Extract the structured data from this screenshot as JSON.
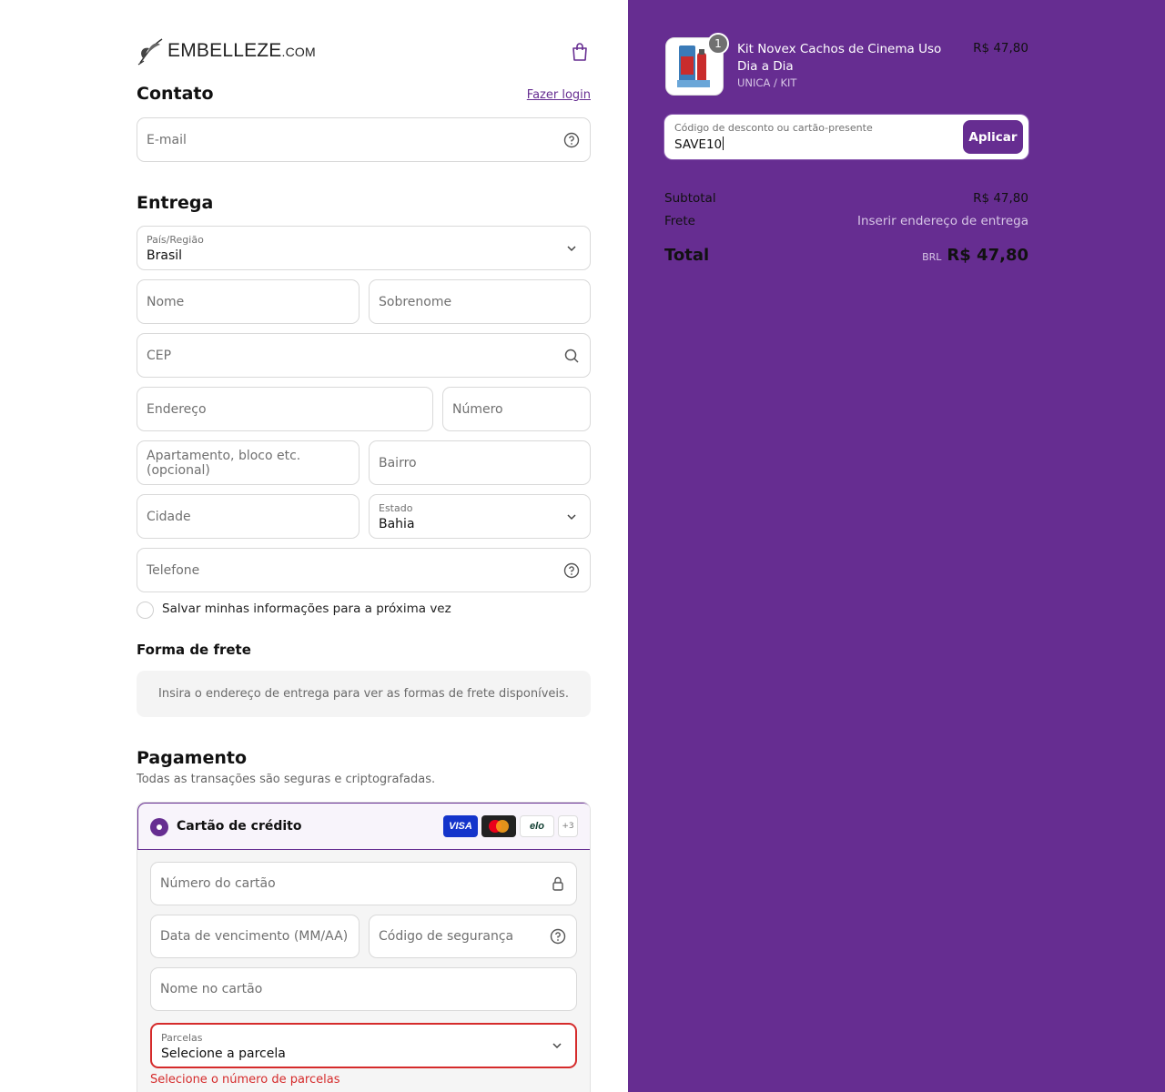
{
  "brand": {
    "name": "EMBELLEZE",
    "suffix": ".COM"
  },
  "contact": {
    "title": "Contato",
    "login_link": "Fazer login",
    "email_placeholder": "E-mail"
  },
  "delivery": {
    "title": "Entrega",
    "country_label": "País/Região",
    "country_value": "Brasil",
    "first_name": "Nome",
    "last_name": "Sobrenome",
    "cep": "CEP",
    "address": "Endereço",
    "number": "Número",
    "apartment": "Apartamento, bloco etc. (opcional)",
    "district": "Bairro",
    "city": "Cidade",
    "state_label": "Estado",
    "state_value": "Bahia",
    "phone": "Telefone",
    "save_info": "Salvar minhas informações para a próxima vez"
  },
  "shipping": {
    "title": "Forma de frete",
    "notice": "Insira o endereço de entrega para ver as formas de frete disponíveis."
  },
  "payment": {
    "title": "Pagamento",
    "subtitle": "Todas as transações são seguras e criptografadas.",
    "method": "Cartão de crédito",
    "badges": {
      "visa": "VISA",
      "elo": "elo",
      "more": "+3"
    },
    "card_number": "Número do cartão",
    "expiry": "Data de vencimento (MM/AA)",
    "cvv": "Código de segurança",
    "name_on_card": "Nome no cartão",
    "installments_label": "Parcelas",
    "installments_value": "Selecione a parcela",
    "installments_error": "Selecione o número de parcelas"
  },
  "summary": {
    "item": {
      "quantity": "1",
      "name": "Kit Novex Cachos de Cinema Uso Dia a Dia",
      "variant": "UNICA / KIT",
      "price": "R$ 47,80"
    },
    "discount": {
      "label": "Código de desconto ou cartão-presente",
      "value": "SAVE10",
      "apply": "Aplicar"
    },
    "subtotal_label": "Subtotal",
    "subtotal_value": "R$ 47,80",
    "shipping_label": "Frete",
    "shipping_value": "Inserir endereço de entrega",
    "total_label": "Total",
    "currency": "BRL",
    "total_value": "R$ 47,80"
  },
  "colors": {
    "accent": "#662d91",
    "error": "#d52b2b"
  }
}
